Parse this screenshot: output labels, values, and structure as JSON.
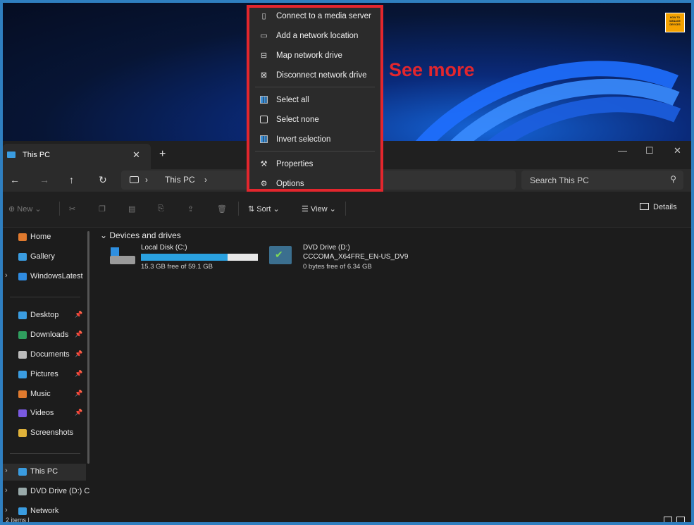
{
  "overflow_menu": {
    "items": [
      {
        "label": "Connect to a media server",
        "icon": "media-server-icon"
      },
      {
        "label": "Add a network location",
        "icon": "network-location-icon"
      },
      {
        "label": "Map network drive",
        "icon": "map-drive-icon"
      },
      {
        "label": "Disconnect network drive",
        "icon": "disconnect-drive-icon"
      },
      {
        "label": "Select all",
        "icon": "select-all-icon"
      },
      {
        "label": "Select none",
        "icon": "select-none-icon"
      },
      {
        "label": "Invert selection",
        "icon": "invert-selection-icon"
      },
      {
        "label": "Properties",
        "icon": "wrench-icon"
      },
      {
        "label": "Options",
        "icon": "gear-icon"
      }
    ]
  },
  "annotation": {
    "label": "See more",
    "color": "#e3262d"
  },
  "window": {
    "tab_title": "This PC",
    "address": {
      "location": "This PC"
    },
    "search_placeholder": "Search This PC"
  },
  "toolbar": {
    "new_label": "New",
    "sort_label": "Sort",
    "view_label": "View",
    "more_label": "...",
    "details_label": "Details"
  },
  "sidebar": {
    "items": [
      {
        "label": "Home",
        "icon": "home-icon"
      },
      {
        "label": "Gallery",
        "icon": "gallery-icon"
      },
      {
        "label": "WindowsLatest",
        "icon": "cloud-icon"
      },
      {
        "label": "Desktop",
        "icon": "desktop-icon"
      },
      {
        "label": "Downloads",
        "icon": "download-icon"
      },
      {
        "label": "Documents",
        "icon": "documents-icon"
      },
      {
        "label": "Pictures",
        "icon": "pictures-icon"
      },
      {
        "label": "Music",
        "icon": "music-icon"
      },
      {
        "label": "Videos",
        "icon": "videos-icon"
      },
      {
        "label": "Screenshots",
        "icon": "folder-icon"
      },
      {
        "label": "This PC",
        "icon": "pc-icon"
      },
      {
        "label": "DVD Drive (D:) C",
        "icon": "dvd-icon"
      },
      {
        "label": "Network",
        "icon": "network-icon"
      }
    ]
  },
  "content": {
    "group_header": "Devices and drives",
    "drives": [
      {
        "name": "Local Disk (C:)",
        "free_text": "15.3 GB free of 59.1 GB",
        "used_fraction": 0.74
      },
      {
        "name": "DVD Drive (D:)",
        "subtitle": "CCCOMA_X64FRE_EN-US_DV9",
        "free_text": "0 bytes free of 6.34 GB"
      }
    ]
  },
  "status": {
    "items_text": "2 items |"
  },
  "logo": {
    "text": "HOW TO MANAGE DEVICES"
  }
}
